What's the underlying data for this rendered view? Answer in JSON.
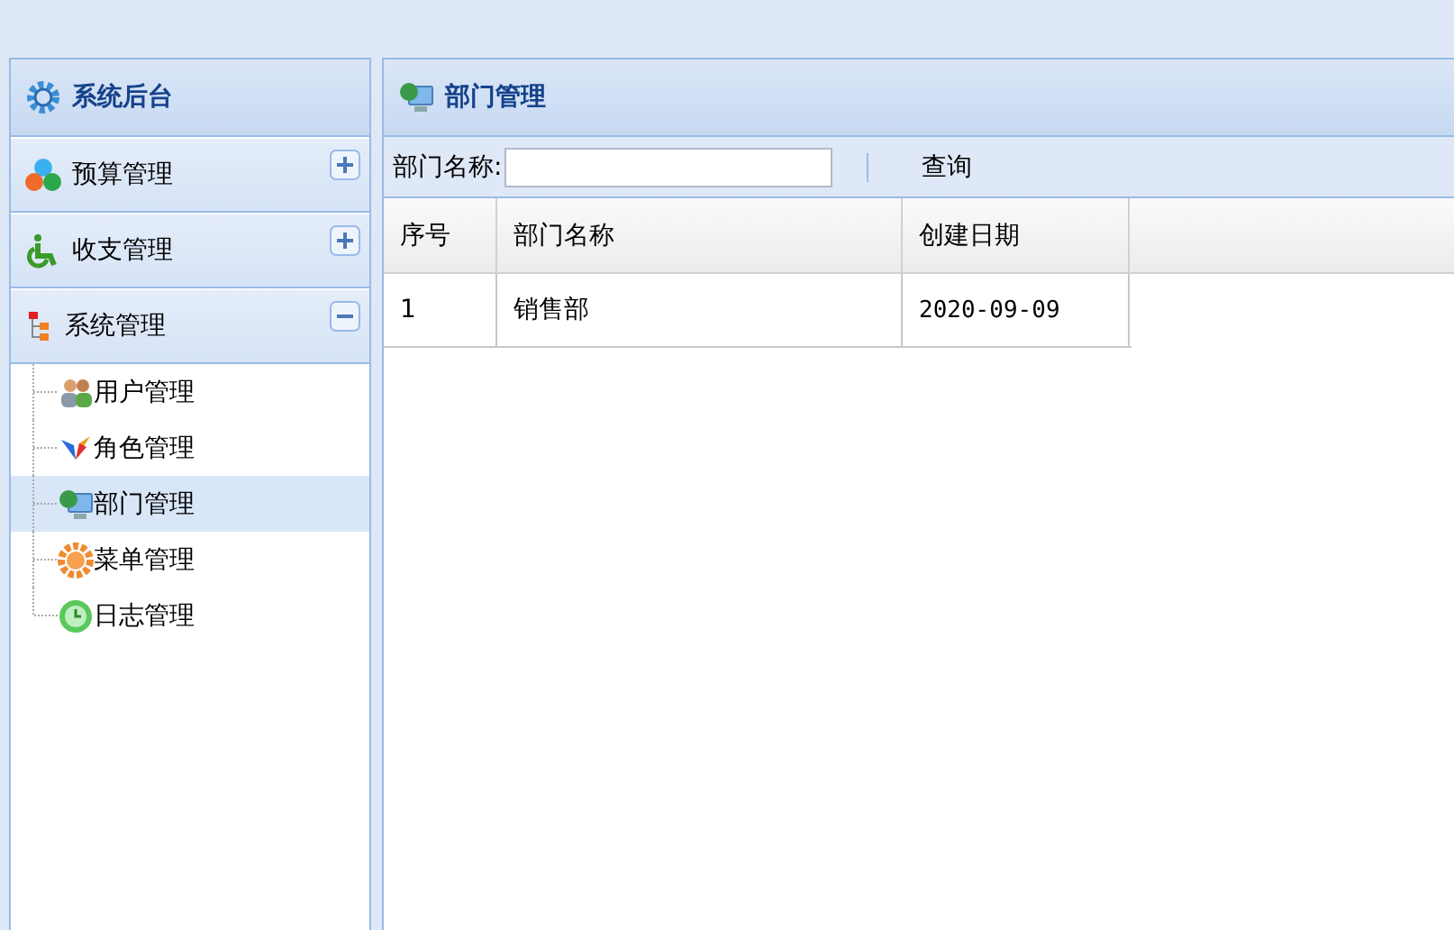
{
  "sidebar": {
    "title": "系统后台",
    "sections": [
      {
        "label": "预算管理",
        "expanded": false
      },
      {
        "label": "收支管理",
        "expanded": false
      },
      {
        "label": "系统管理",
        "expanded": true,
        "children": [
          {
            "label": "用户管理",
            "selected": false
          },
          {
            "label": "角色管理",
            "selected": false
          },
          {
            "label": "部门管理",
            "selected": true
          },
          {
            "label": "菜单管理",
            "selected": false
          },
          {
            "label": "日志管理",
            "selected": false
          }
        ]
      }
    ]
  },
  "main": {
    "title": "部门管理",
    "search": {
      "label": "部门名称:"
    },
    "query_button": "查询",
    "table": {
      "columns": [
        "序号",
        "部门名称",
        "创建日期"
      ],
      "rows": [
        [
          "1",
          "销售部",
          "2020-09-09"
        ]
      ]
    }
  }
}
